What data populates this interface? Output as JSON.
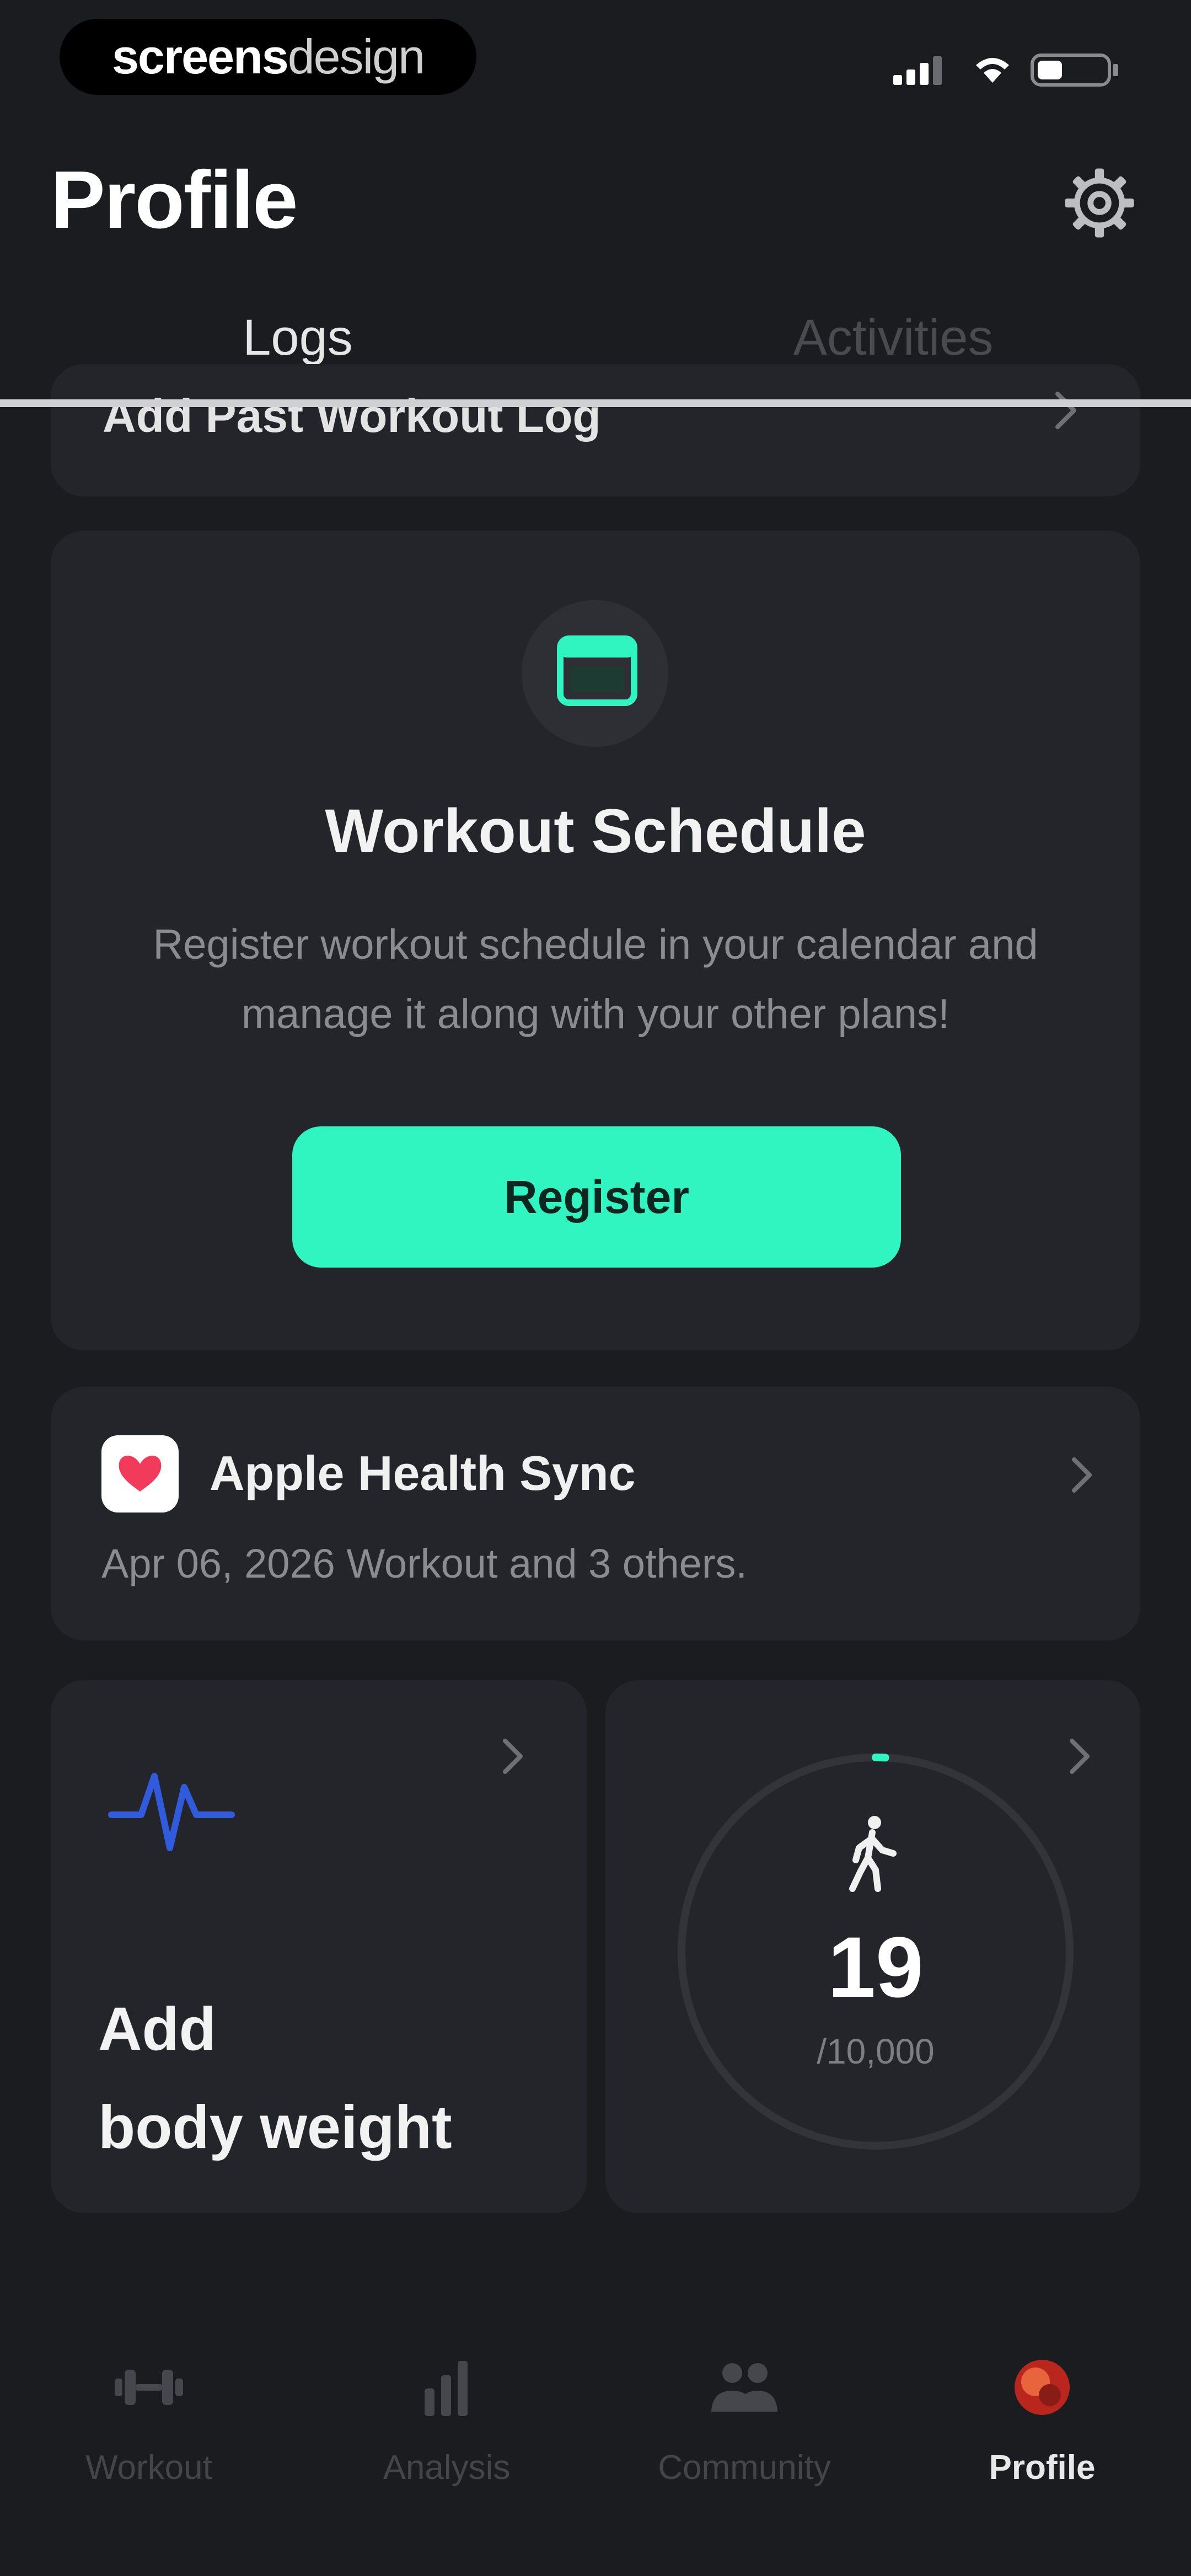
{
  "status_bar": {
    "brand_bold": "screens",
    "brand_light": "design"
  },
  "header": {
    "title": "Profile",
    "settings_icon": "gear-icon"
  },
  "tabs": [
    {
      "label": "Logs",
      "active": true
    },
    {
      "label": "Activities",
      "active": false
    }
  ],
  "past_log": {
    "label": "Add Past Workout Log"
  },
  "schedule": {
    "icon": "calendar-icon",
    "title": "Workout Schedule",
    "description": "Register workout schedule in your calendar and manage it along with your other plans!",
    "button_label": "Register"
  },
  "health_sync": {
    "icon": "heart-icon",
    "title": "Apple Health Sync",
    "subtitle": "Apr 06, 2026 Workout and 3 others."
  },
  "body_weight": {
    "icon": "pulse-icon",
    "line1": "Add",
    "line2": "body weight"
  },
  "steps": {
    "icon": "walking-icon",
    "count": "19",
    "goal": "/10,000",
    "progress_fraction": 0.0019
  },
  "nav": [
    {
      "label": "Workout",
      "icon": "dumbbell-icon",
      "active": false
    },
    {
      "label": "Analysis",
      "icon": "bar-chart-icon",
      "active": false
    },
    {
      "label": "Community",
      "icon": "people-icon",
      "active": false
    },
    {
      "label": "Profile",
      "icon": "avatar-icon",
      "active": true
    }
  ],
  "colors": {
    "background": "#1b1c20",
    "card": "#24252a",
    "accent": "#31f5c0",
    "pulse": "#2f5bdc"
  }
}
